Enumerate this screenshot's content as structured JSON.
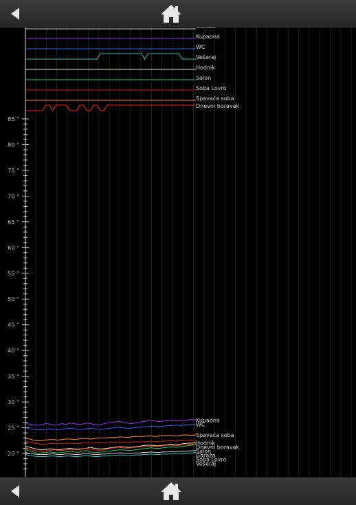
{
  "nav": {
    "top": {
      "back_icon": "back-arrow-icon",
      "home_icon": "home-icon"
    },
    "bottom": {
      "back_icon": "back-arrow-icon",
      "home_icon": "home-icon"
    }
  },
  "chart_data": {
    "type": "line",
    "y_ticks": [
      20,
      25,
      30,
      35,
      40,
      45,
      50,
      55,
      60,
      65,
      70,
      75,
      80,
      85
    ],
    "y_tick_suffix": " °",
    "ylim": [
      17,
      85
    ],
    "grid": true,
    "state_series": [
      {
        "name": "Garaža",
        "color": "#d0d0d0",
        "states": [
          0,
          0,
          0,
          0,
          0,
          0,
          0,
          0,
          0,
          0,
          0,
          0,
          0,
          0,
          0,
          0,
          0,
          0,
          0,
          0,
          0,
          0,
          0,
          0,
          0,
          0,
          0,
          0,
          0,
          0,
          0,
          0,
          0,
          0,
          0,
          0,
          0,
          0,
          0,
          0,
          0,
          0,
          0,
          0,
          0,
          0,
          0,
          0,
          0,
          0,
          0
        ]
      },
      {
        "name": "Kupaona",
        "color": "#9b30ff",
        "states": [
          0,
          0,
          0,
          0,
          0,
          0,
          0,
          0,
          0,
          0,
          0,
          0,
          0,
          0,
          0,
          0,
          0,
          0,
          0,
          0,
          0,
          0,
          0,
          0,
          0,
          0,
          0,
          0,
          0,
          0,
          0,
          0,
          0,
          0,
          0,
          0,
          0,
          0,
          0,
          0,
          0,
          0,
          0,
          0,
          0,
          0,
          0,
          0,
          0,
          0,
          0
        ]
      },
      {
        "name": "WC",
        "color": "#3060ff",
        "states": [
          0,
          0,
          0,
          0,
          0,
          0,
          0,
          0,
          0,
          0,
          0,
          0,
          0,
          0,
          0,
          0,
          0,
          0,
          0,
          0,
          0,
          0,
          0,
          0,
          0,
          0,
          0,
          0,
          0,
          0,
          0,
          0,
          0,
          0,
          0,
          0,
          0,
          0,
          0,
          0,
          0,
          0,
          0,
          0,
          0,
          0,
          0,
          0,
          0,
          0,
          0
        ]
      },
      {
        "name": "Vešeraj",
        "color": "#20c8c8",
        "states": [
          0,
          0,
          0,
          0,
          0,
          0,
          0,
          0,
          0,
          0,
          0,
          0,
          0,
          0,
          0,
          0,
          0,
          0,
          0,
          0,
          0,
          0,
          1,
          1,
          1,
          1,
          1,
          1,
          1,
          1,
          1,
          1,
          1,
          1,
          1,
          0,
          1,
          1,
          1,
          1,
          1,
          1,
          1,
          1,
          1,
          1,
          0,
          0,
          0,
          0,
          0
        ]
      },
      {
        "name": "Hodnik",
        "color": "#e8e8b0",
        "states": [
          0,
          0,
          0,
          0,
          0,
          0,
          0,
          0,
          0,
          0,
          0,
          0,
          0,
          0,
          0,
          0,
          0,
          0,
          0,
          0,
          0,
          0,
          0,
          0,
          0,
          0,
          0,
          0,
          0,
          0,
          0,
          0,
          0,
          0,
          0,
          0,
          0,
          0,
          0,
          0,
          0,
          0,
          0,
          0,
          0,
          0,
          0,
          0,
          0,
          0,
          0
        ]
      },
      {
        "name": "Salon",
        "color": "#20d060",
        "states": [
          0,
          0,
          0,
          0,
          0,
          0,
          0,
          0,
          0,
          0,
          0,
          0,
          0,
          0,
          0,
          0,
          0,
          0,
          0,
          0,
          0,
          0,
          0,
          0,
          0,
          0,
          0,
          0,
          0,
          0,
          0,
          0,
          0,
          0,
          0,
          0,
          0,
          0,
          0,
          0,
          0,
          0,
          0,
          0,
          0,
          0,
          0,
          0,
          0,
          0,
          0
        ]
      },
      {
        "name": "Soba Lovro",
        "color": "#d02020",
        "states": [
          0,
          0,
          0,
          0,
          0,
          0,
          0,
          0,
          0,
          0,
          0,
          0,
          0,
          0,
          0,
          0,
          0,
          0,
          0,
          0,
          0,
          0,
          0,
          0,
          0,
          0,
          0,
          0,
          0,
          0,
          0,
          0,
          0,
          0,
          0,
          0,
          0,
          0,
          0,
          0,
          0,
          0,
          0,
          0,
          0,
          0,
          0,
          0,
          0,
          0,
          0
        ]
      },
      {
        "name": "Spavaća soba",
        "color": "#ff8c20",
        "states": [
          0,
          0,
          0,
          0,
          0,
          0,
          0,
          0,
          0,
          0,
          0,
          0,
          0,
          0,
          0,
          0,
          0,
          0,
          0,
          0,
          0,
          0,
          0,
          0,
          0,
          0,
          0,
          0,
          0,
          0,
          0,
          0,
          0,
          0,
          0,
          0,
          0,
          0,
          0,
          0,
          0,
          0,
          0,
          0,
          0,
          0,
          0,
          0,
          0,
          0,
          0
        ]
      },
      {
        "name": "Dnevni boravak",
        "color": "#ff2020",
        "states": [
          0,
          0,
          0,
          0,
          0,
          0,
          1,
          1,
          0,
          1,
          1,
          1,
          1,
          0,
          0,
          0,
          1,
          1,
          0,
          0,
          1,
          1,
          0,
          0,
          1,
          1,
          1,
          1,
          1,
          1,
          1,
          1,
          1,
          1,
          1,
          1,
          1,
          1,
          1,
          1,
          1,
          1,
          1,
          1,
          1,
          1,
          1,
          1,
          1,
          1,
          1
        ]
      }
    ],
    "series": [
      {
        "name": "Kupaona",
        "color": "#9b30ff",
        "values": [
          25.9,
          25.7,
          25.6,
          25.5,
          25.6,
          25.8,
          25.7,
          25.5,
          25.6,
          25.8,
          25.6,
          25.9,
          25.8,
          25.6,
          25.7,
          25.9,
          25.8,
          25.6,
          25.5,
          25.7,
          25.9,
          26.0,
          26.1,
          26.2,
          26.1,
          25.9,
          25.8,
          25.9,
          26.0,
          26.2,
          26.3,
          26.4,
          26.3,
          26.2,
          26.3,
          26.4,
          26.5,
          26.4,
          26.3,
          26.4,
          26.5,
          26.6,
          26.5
        ]
      },
      {
        "name": "WC",
        "color": "#3060ff",
        "values": [
          25.0,
          24.8,
          24.7,
          24.6,
          24.6,
          24.7,
          24.8,
          24.7,
          24.6,
          24.7,
          24.8,
          24.9,
          24.8,
          24.7,
          24.7,
          24.8,
          24.9,
          24.8,
          24.7,
          24.7,
          24.8,
          24.9,
          25.0,
          25.1,
          25.0,
          24.9,
          24.9,
          25.0,
          25.1,
          25.2,
          25.2,
          25.3,
          25.3,
          25.2,
          25.3,
          25.4,
          25.4,
          25.5,
          25.4,
          25.5,
          25.6,
          25.6,
          25.7
        ]
      },
      {
        "name": "Spavaća soba",
        "color": "#ff8c20",
        "values": [
          23.0,
          22.8,
          22.6,
          22.5,
          22.5,
          22.6,
          22.7,
          22.7,
          22.6,
          22.7,
          22.8,
          22.8,
          22.7,
          22.8,
          22.9,
          22.9,
          22.8,
          22.9,
          23.0,
          23.0,
          23.0,
          23.1,
          23.1,
          23.2,
          23.2,
          23.1,
          23.2,
          23.3,
          23.3,
          23.3,
          23.4,
          23.4,
          23.3,
          23.4,
          23.5,
          23.5,
          23.5,
          23.4,
          23.5,
          23.6,
          23.6,
          23.5,
          23.6
        ]
      },
      {
        "name": "Soba Lovro",
        "color": "#d02020",
        "values": [
          22.4,
          22.2,
          22.0,
          21.9,
          21.8,
          21.8,
          21.9,
          22.0,
          21.9,
          21.9,
          22.0,
          22.0,
          21.9,
          21.9,
          22.0,
          22.1,
          22.0,
          22.0,
          22.1,
          22.1,
          22.0,
          22.1,
          22.2,
          22.2,
          22.1,
          22.2,
          22.2,
          22.3,
          22.2,
          22.3,
          22.3,
          22.4,
          22.3,
          22.3,
          22.4,
          22.4,
          22.5,
          22.4,
          22.5,
          22.5,
          22.6,
          22.5,
          22.6
        ]
      },
      {
        "name": "Hodnik",
        "color": "#e8e8b0",
        "values": [
          21.4,
          21.2,
          21.0,
          20.8,
          20.7,
          20.8,
          20.9,
          20.8,
          20.7,
          20.8,
          20.9,
          21.0,
          20.9,
          20.8,
          20.9,
          21.0,
          21.2,
          21.0,
          20.9,
          20.9,
          21.0,
          21.1,
          21.2,
          21.3,
          21.3,
          21.2,
          21.2,
          21.3,
          21.4,
          21.5,
          21.6,
          21.6,
          21.5,
          21.5,
          21.6,
          21.7,
          21.8,
          21.7,
          21.8,
          21.9,
          22.0,
          22.0,
          22.1
        ]
      },
      {
        "name": "Dnevni boravak",
        "color": "#ff2020",
        "values": [
          21.0,
          20.8,
          20.6,
          20.5,
          20.4,
          20.5,
          20.6,
          20.7,
          20.6,
          20.6,
          20.7,
          20.8,
          20.7,
          20.7,
          20.8,
          21.0,
          20.8,
          20.7,
          20.6,
          20.7,
          20.8,
          21.0,
          21.1,
          21.2,
          21.1,
          21.0,
          21.1,
          21.2,
          21.3,
          21.3,
          21.4,
          21.4,
          21.3,
          21.4,
          21.5,
          21.6,
          21.6,
          21.5,
          21.6,
          21.7,
          21.8,
          21.8,
          21.9
        ]
      },
      {
        "name": "Salon",
        "color": "#20d060",
        "values": [
          20.8,
          20.5,
          20.3,
          20.1,
          20.1,
          20.2,
          20.3,
          20.2,
          20.1,
          20.2,
          20.3,
          20.4,
          20.3,
          20.2,
          20.4,
          20.6,
          20.3,
          20.2,
          20.2,
          20.3,
          20.4,
          20.5,
          20.6,
          20.7,
          20.7,
          20.6,
          20.6,
          20.7,
          20.8,
          20.9,
          21.0,
          21.1,
          21.0,
          21.0,
          21.1,
          21.2,
          21.3,
          21.2,
          21.3,
          21.4,
          21.5,
          21.6,
          21.7
        ]
      },
      {
        "name": "Garaža",
        "color": "#d0d0d0",
        "values": [
          20.2,
          20.0,
          19.9,
          19.8,
          19.8,
          19.8,
          19.9,
          19.9,
          19.8,
          19.8,
          19.9,
          19.9,
          19.8,
          19.8,
          19.9,
          20.0,
          19.9,
          19.8,
          19.8,
          19.9,
          19.9,
          20.0,
          20.0,
          20.1,
          20.1,
          20.0,
          20.0,
          20.1,
          20.1,
          20.2,
          20.2,
          20.3,
          20.2,
          20.2,
          20.3,
          20.3,
          20.4,
          20.3,
          20.4,
          20.4,
          20.5,
          20.5,
          20.6
        ]
      },
      {
        "name": "Vešeraj",
        "color": "#20c8c8",
        "values": [
          19.8,
          19.6,
          19.5,
          19.4,
          19.4,
          19.4,
          19.5,
          19.5,
          19.4,
          19.4,
          19.5,
          19.5,
          19.4,
          19.4,
          19.5,
          19.6,
          19.5,
          19.4,
          19.4,
          19.5,
          19.5,
          19.6,
          19.6,
          19.7,
          19.7,
          19.6,
          19.6,
          19.7,
          19.7,
          19.8,
          19.8,
          19.9,
          19.8,
          19.8,
          19.9,
          19.9,
          20.0,
          19.9,
          20.0,
          20.0,
          20.1,
          20.1,
          20.2
        ]
      }
    ],
    "legend_labels_bottom": [
      "Kupaona",
      "WC",
      "Spavaća soba",
      "Hodnik",
      "Dnevni boravak",
      "Salon",
      "Garaža",
      "Soba Lovro",
      "Vešeraj"
    ]
  }
}
